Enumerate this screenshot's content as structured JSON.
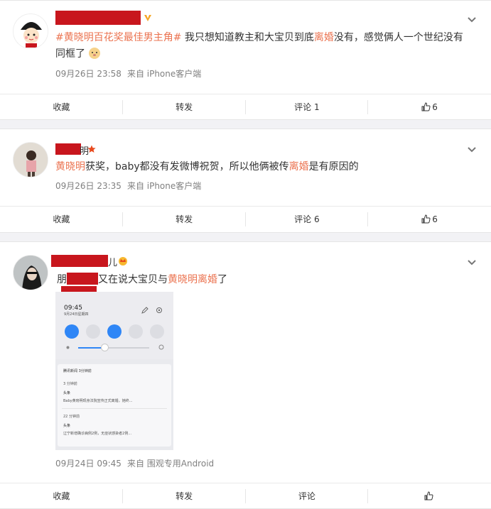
{
  "posts": [
    {
      "text_parts": [
        {
          "t": "#黄晓明百花奖最佳男主角#",
          "style": "tag"
        },
        {
          "t": " 我只想知道教主和大宝贝到底",
          "style": "normal"
        },
        {
          "t": "离婚",
          "style": "hl"
        },
        {
          "t": "没有，感觉俩人一个世纪没有同框了",
          "style": "normal"
        }
      ],
      "time": "09月26日 23:58",
      "source": "来自 iPhone客户端",
      "actions": {
        "favorite": "收藏",
        "repost": "转发",
        "comment": "评论 1",
        "like": "6"
      }
    },
    {
      "text_parts": [
        {
          "t": "黄晓明",
          "style": "hl"
        },
        {
          "t": "获奖，baby都没有发微博祝贺，所以他俩被传",
          "style": "normal"
        },
        {
          "t": "离婚",
          "style": "hl"
        },
        {
          "t": "是有原因的",
          "style": "normal"
        }
      ],
      "name_suffix": "明",
      "time": "09月26日 23:35",
      "source": "来自 iPhone客户端",
      "actions": {
        "favorite": "收藏",
        "repost": "转发",
        "comment": "评论 6",
        "like": "6"
      }
    },
    {
      "text_prefix": "朋",
      "text_parts": [
        {
          "t": "又在说大宝贝与",
          "style": "normal"
        },
        {
          "t": "黄晓明离婚",
          "style": "hl"
        },
        {
          "t": "了",
          "style": "normal"
        }
      ],
      "name_suffix": "儿",
      "time": "09月24日 09:45",
      "source": "来自 围观专用Android",
      "actions": {
        "favorite": "收藏",
        "repost": "转发",
        "comment": "评论",
        "like": ""
      },
      "screenshot": {
        "time": "09:45",
        "date": "9月24日星期四",
        "notif_app": "腾讯新闻 3分钟前",
        "n1_time": "3 分钟前",
        "n1_title": "头条",
        "n1_body": "Baby黄晓明现身法院宣传正式离婚，她终...",
        "n2_time": "22 分钟前",
        "n2_title": "头条",
        "n2_body": "辽宁新增确诊病例2例，无症状感染者2例..."
      }
    }
  ]
}
